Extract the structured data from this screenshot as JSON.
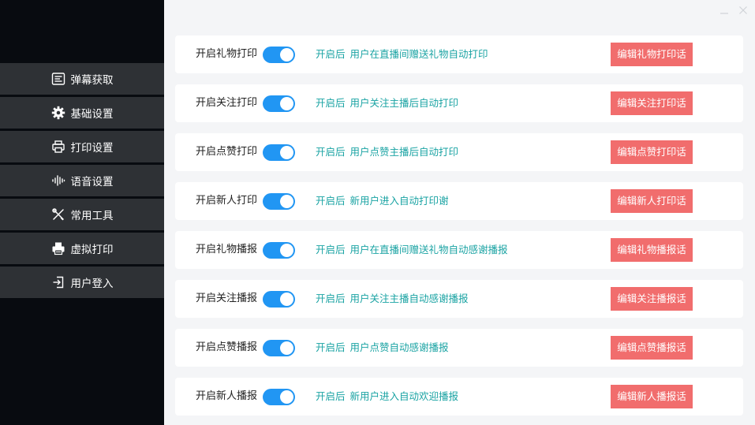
{
  "colors": {
    "sidebar_bg": "#080b10",
    "menu_item_bg": "#2e3135",
    "toggle_on": "#2196f3",
    "desc_text": "#1aa3a3",
    "edit_button": "#f16d6d",
    "content_bg": "#f4f5f7"
  },
  "window_controls": {
    "minimize_icon": "minimize-icon",
    "close_icon": "close-icon"
  },
  "sidebar": {
    "items": [
      {
        "label": "弹幕获取",
        "icon": "danmaku-list-icon"
      },
      {
        "label": "基础设置",
        "icon": "gear-icon"
      },
      {
        "label": "打印设置",
        "icon": "printer-icon"
      },
      {
        "label": "语音设置",
        "icon": "voice-wave-icon"
      },
      {
        "label": "常用工具",
        "icon": "tools-icon"
      },
      {
        "label": "虚拟打印",
        "icon": "virtual-printer-icon"
      },
      {
        "label": "用户登入",
        "icon": "login-icon"
      }
    ]
  },
  "settings": {
    "enabled_prefix": "开启后",
    "rows": [
      {
        "label": "开启礼物打印",
        "enabled": true,
        "desc": "用户在直播间赠送礼物自动打印",
        "button": "编辑礼物打印话"
      },
      {
        "label": "开启关注打印",
        "enabled": true,
        "desc": "用户关注主播后自动打印",
        "button": "编辑关注打印话"
      },
      {
        "label": "开启点赞打印",
        "enabled": true,
        "desc": "用户点赞主播后自动打印",
        "button": "编辑点赞打印话"
      },
      {
        "label": "开启新人打印",
        "enabled": true,
        "desc": "新用户进入自动打印谢",
        "button": "编辑新人打印话"
      },
      {
        "label": "开启礼物播报",
        "enabled": true,
        "desc": "用户在直播间赠送礼物自动感谢播报",
        "button": "编辑礼物播报话"
      },
      {
        "label": "开启关注播报",
        "enabled": true,
        "desc": "用户关注主播自动感谢播报",
        "button": "编辑关注播报话"
      },
      {
        "label": "开启点赞播报",
        "enabled": true,
        "desc": "用户点赞自动感谢播报",
        "button": "编辑点赞播报话"
      },
      {
        "label": "开启新人播报",
        "enabled": true,
        "desc": "新用户进入自动欢迎播报",
        "button": "编辑新人播报话"
      }
    ]
  }
}
